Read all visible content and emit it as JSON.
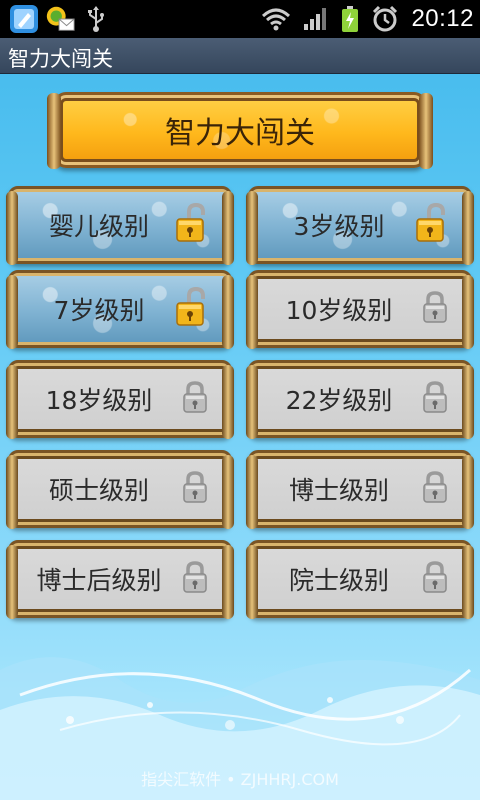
{
  "status_bar": {
    "time": "20:12",
    "icons": [
      "notes-app-icon",
      "messenger-mail-icon",
      "usb-icon",
      "wifi-icon",
      "signal-icon",
      "battery-charging-icon",
      "alarm-icon"
    ]
  },
  "app": {
    "title": "智力大闯关"
  },
  "header": {
    "banner_text": "智力大闯关"
  },
  "levels": [
    {
      "label": "婴儿级别",
      "locked": false
    },
    {
      "label": "3岁级别",
      "locked": false
    },
    {
      "label": "7岁级别",
      "locked": false
    },
    {
      "label": "10岁级别",
      "locked": true
    },
    {
      "label": "18岁级别",
      "locked": true
    },
    {
      "label": "22岁级别",
      "locked": true
    },
    {
      "label": "硕士级别",
      "locked": true
    },
    {
      "label": "博士级别",
      "locked": true
    },
    {
      "label": "博士后级别",
      "locked": true
    },
    {
      "label": "院士级别",
      "locked": true
    }
  ],
  "watermark": "指尖汇软件 • ZJHHRJ.COM",
  "colors": {
    "title_bar": "#3f5068",
    "unlocked_tile": "#7fb2d2",
    "locked_tile": "#d4d4d4",
    "banner": "#ffb81c"
  }
}
